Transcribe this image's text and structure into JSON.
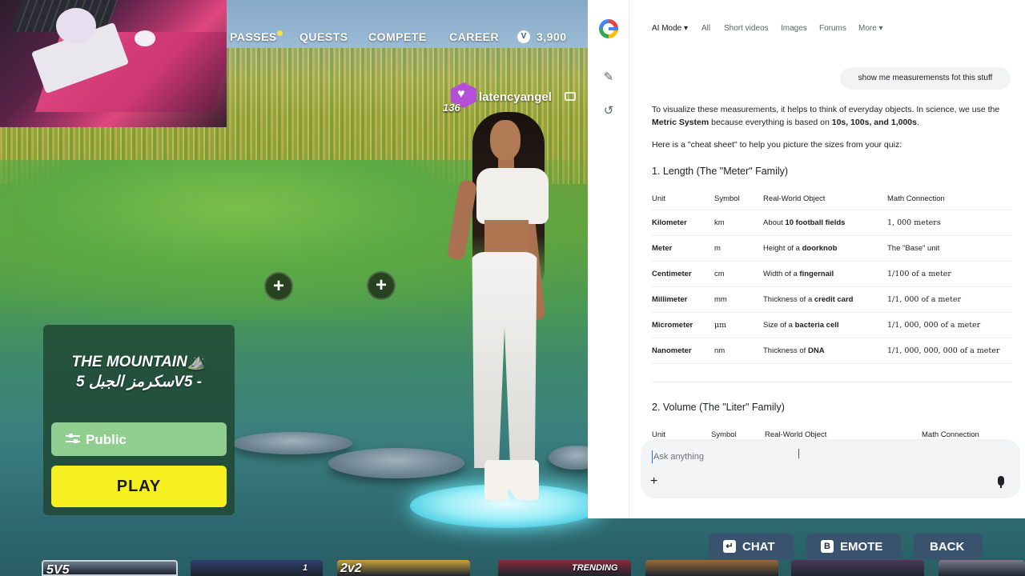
{
  "game": {
    "nav": [
      "PASSES",
      "QUESTS",
      "COMPETE",
      "CAREER"
    ],
    "vbucks_icon": "V",
    "vbucks": "3,900",
    "player": {
      "name": "latencyangel",
      "level": "136",
      "badge_icon": "heart-icon"
    },
    "island": {
      "title_line1": "THE MOUNTAIN⛰️",
      "title_line2": "سكرمز الجبل 5V5 -",
      "privacy": "Public",
      "play": "PLAY"
    },
    "plus_symbol": "+",
    "bottom_buttons": [
      {
        "key": "↵",
        "label": "CHAT"
      },
      {
        "key": "B",
        "label": "EMOTE"
      },
      {
        "label": "BACK"
      }
    ],
    "carousel": [
      {
        "text": "5V5",
        "color": "#6f7d8c"
      },
      {
        "text": "1",
        "color": "#2f3d6a"
      },
      {
        "text": "2v2",
        "color": "#c9a23a"
      },
      {
        "text": "TRENDING",
        "color": "#8a2a3a"
      },
      {
        "text": "",
        "color": "#9a6a3a"
      },
      {
        "text": "",
        "color": "#4a3a5a"
      },
      {
        "text": "",
        "color": "#7a7a8a"
      }
    ]
  },
  "browser": {
    "tabs": [
      "AI Mode ▾",
      "All",
      "Short videos",
      "Images",
      "Forums",
      "More ▾"
    ],
    "rail_icons": [
      "google-logo",
      "new-chat-icon",
      "history-icon"
    ],
    "user_query": "show me measuremensts fot this stuff",
    "intro_1": "To visualize these measurements, it helps to think of everyday objects. In science, we use the ",
    "intro_bold_1": "Metric System",
    "intro_2": " because everything is based on ",
    "intro_bold_2": "10s, 100s, and 1,000s",
    "intro_3": ".",
    "cheat_intro": "Here is a \"cheat sheet\" to help you picture the sizes from your quiz:",
    "section1": "1. Length (The \"Meter\" Family)",
    "headers": [
      "Unit",
      "Symbol",
      "Real-World Object",
      "Math Connection"
    ],
    "rows": [
      [
        "Kilometer",
        "km",
        "About ",
        "10 football fields",
        "",
        "1, 000 meters"
      ],
      [
        "Meter",
        "m",
        "Height of a ",
        "doorknob",
        "",
        "The \"Base\" unit"
      ],
      [
        "Centimeter",
        "cm",
        "Width of a ",
        "fingernail",
        "",
        "1/100 of a meter"
      ],
      [
        "Millimeter",
        "mm",
        "Thickness of a ",
        "credit card",
        "",
        "1/1, 000 of a meter"
      ],
      [
        "Micrometer",
        "μm",
        "Size of a ",
        "bacteria cell",
        "",
        "1/1, 000, 000 of a meter"
      ],
      [
        "Nanometer",
        "nm",
        "Thickness of ",
        "DNA",
        "",
        "1/1, 000, 000, 000 of a meter"
      ]
    ],
    "section2": "2. Volume (The \"Liter\" Family)",
    "ask_placeholder": "Ask anything",
    "ask_plus": "+"
  }
}
